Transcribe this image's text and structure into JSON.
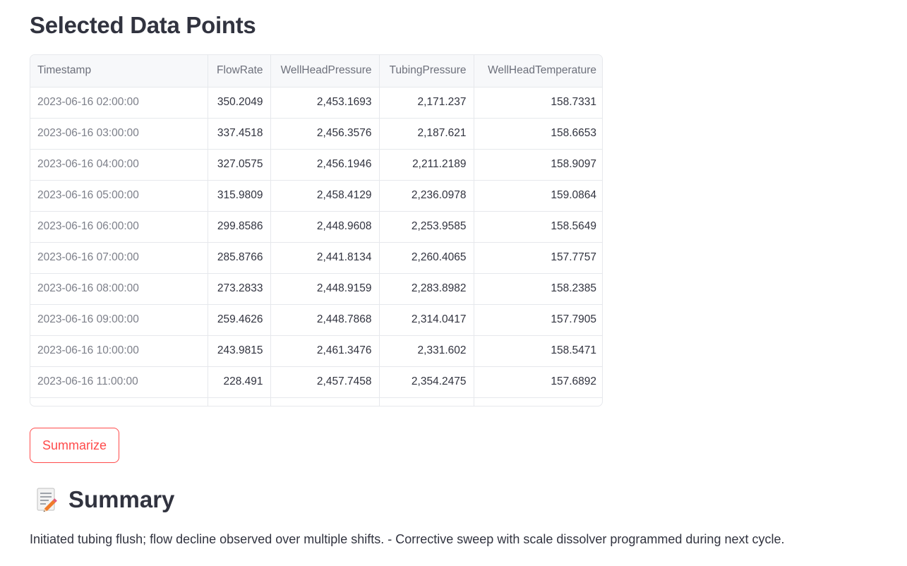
{
  "selected": {
    "title": "Selected Data Points",
    "columns": [
      "Timestamp",
      "FlowRate",
      "WellHeadPressure",
      "TubingPressure",
      "WellHeadTemperature"
    ],
    "rows": [
      [
        "2023-06-16 02:00:00",
        "350.2049",
        "2,453.1693",
        "2,171.237",
        "158.7331"
      ],
      [
        "2023-06-16 03:00:00",
        "337.4518",
        "2,456.3576",
        "2,187.621",
        "158.6653"
      ],
      [
        "2023-06-16 04:00:00",
        "327.0575",
        "2,456.1946",
        "2,211.2189",
        "158.9097"
      ],
      [
        "2023-06-16 05:00:00",
        "315.9809",
        "2,458.4129",
        "2,236.0978",
        "159.0864"
      ],
      [
        "2023-06-16 06:00:00",
        "299.8586",
        "2,448.9608",
        "2,253.9585",
        "158.5649"
      ],
      [
        "2023-06-16 07:00:00",
        "285.8766",
        "2,441.8134",
        "2,260.4065",
        "157.7757"
      ],
      [
        "2023-06-16 08:00:00",
        "273.2833",
        "2,448.9159",
        "2,283.8982",
        "158.2385"
      ],
      [
        "2023-06-16 09:00:00",
        "259.4626",
        "2,448.7868",
        "2,314.0417",
        "157.7905"
      ],
      [
        "2023-06-16 10:00:00",
        "243.9815",
        "2,461.3476",
        "2,331.602",
        "158.5471"
      ],
      [
        "2023-06-16 11:00:00",
        "228.491",
        "2,457.7458",
        "2,354.2475",
        "157.6892"
      ]
    ]
  },
  "actions": {
    "summarize_label": "Summarize"
  },
  "summary": {
    "icon": "memo-icon",
    "heading": "Summary",
    "text": "Initiated tubing flush; flow decline observed over multiple shifts. - Corrective sweep with scale dissolver programmed during next cycle."
  },
  "colors": {
    "accent": "#ff4b4b",
    "text": "#31333f",
    "header_bg": "#f7f8fa",
    "border": "#e6e8ec"
  }
}
